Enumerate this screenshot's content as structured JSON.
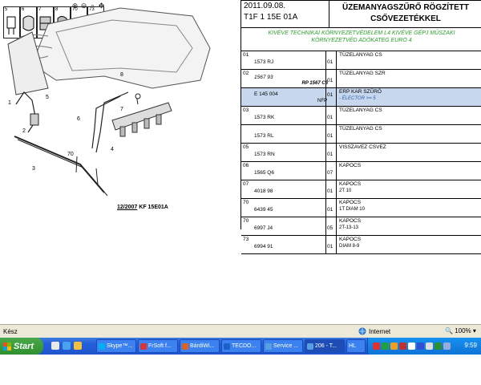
{
  "diagram": {
    "thumbnails": [
      "5",
      "6",
      "7",
      "8",
      "70",
      "73"
    ],
    "callouts": [
      "1",
      "2",
      "3",
      "4",
      "5",
      "6",
      "7",
      "8",
      "70"
    ],
    "caption_date": "12/2007",
    "caption_code": "KF 15E01A"
  },
  "header": {
    "date": "2011.09.08.",
    "code": "T1F 1 15E 01A",
    "title_line1": "ÜZEMANYAGSZŰRŐ RÖGZÍTETT",
    "title_line2": "CSŐVEZETÉKKEL"
  },
  "note": {
    "line1": "KIVÉVE TECHNIKAI KÖRNYEZETVÉDELEM L4 KIVÉVE GÉPJ MŰSZAKI",
    "line2": "KÖRNYEZETVÉD ADÓKATEG EURO 4"
  },
  "rows": [
    {
      "pos": "01",
      "ref": "1573 RJ",
      "qty": "01",
      "desc": "TÜZELANYAG CS",
      "sub": "",
      "extra": ""
    },
    {
      "pos": "02",
      "ref": "1567 93",
      "qty": "01",
      "desc": "TÜZELANYAG SZR",
      "sub": "",
      "extra": "RP 1567 C6"
    },
    {
      "pos": "",
      "ref": "E 145 004",
      "qty": "01",
      "desc": "ERP KAR SZŰRŐ",
      "sub": "- ÉLECTOR >= 5",
      "extra": "NFP"
    },
    {
      "pos": "03",
      "ref": "1573 RK",
      "qty": "01",
      "desc": "TÜZELANYAG CS",
      "sub": "",
      "extra": ""
    },
    {
      "pos": "",
      "ref": "1573 RL",
      "qty": "01",
      "desc": "TÜZELANYAG CS",
      "sub": "",
      "extra": ""
    },
    {
      "pos": "05",
      "ref": "1573 RN",
      "qty": "01",
      "desc": "VISSZAVEZ CSVEZ",
      "sub": "",
      "extra": ""
    },
    {
      "pos": "06",
      "ref": "1565 Q6",
      "qty": "07",
      "desc": "KAPOCS",
      "sub": "",
      "extra": ""
    },
    {
      "pos": "07",
      "ref": "4018 98",
      "qty": "01",
      "desc": "KAPOCS",
      "sub": "2T 10",
      "extra": ""
    },
    {
      "pos": "70",
      "ref": "6439 45",
      "qty": "01",
      "desc": "KAPOCS",
      "sub": "1T DIAM 10",
      "extra": ""
    },
    {
      "pos": "70",
      "ref": "6997 J4",
      "qty": "05",
      "desc": "KAPOCS",
      "sub": "2T-13-13",
      "extra": ""
    },
    {
      "pos": "73",
      "ref": "6994 91",
      "qty": "01",
      "desc": "KAPOCS",
      "sub": "DIAM 8-9",
      "extra": ""
    }
  ],
  "statusbar": {
    "status": "Kész",
    "zone": "Internet",
    "zoom": "100%"
  },
  "taskbar": {
    "start": "Start",
    "tasks": [
      "Skype™...",
      "FrSoft f...",
      "BárdiWi...",
      "TECDO...",
      "Service ...",
      "206 - T...",
      "HL"
    ],
    "clock": "9:59",
    "colors": {
      "taskbar": "#245edb",
      "start": "#3c9a3c",
      "tray": "#0f73d6"
    }
  }
}
